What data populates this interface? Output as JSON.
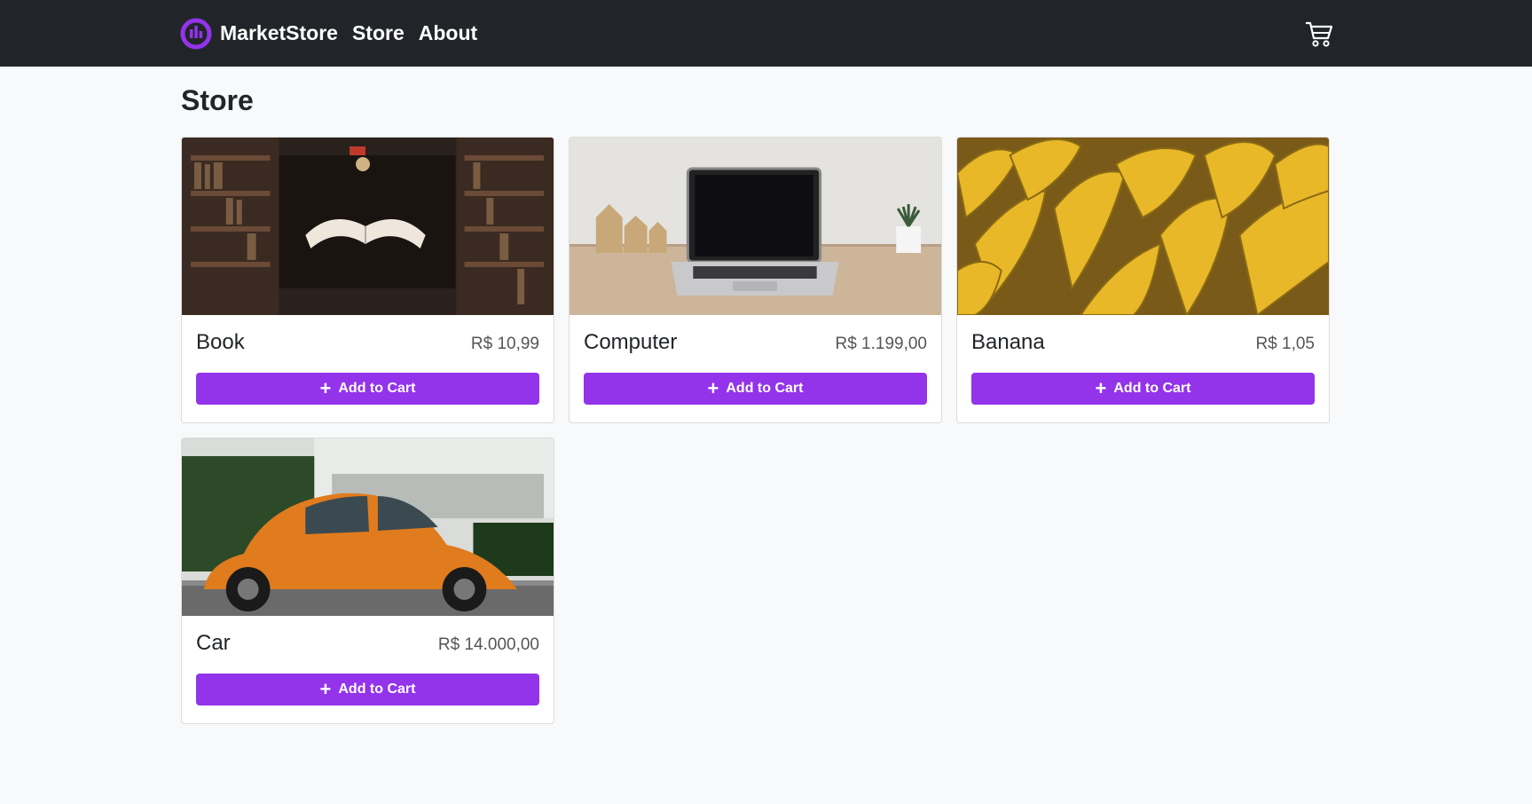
{
  "navbar": {
    "brand": "MarketStore",
    "links": [
      "Store",
      "About"
    ],
    "brand_color": "#9333ea",
    "cart_icon": "shopping-cart-icon"
  },
  "page": {
    "title": "Store"
  },
  "products": [
    {
      "name": "Book",
      "price": "R$ 10,99",
      "button": "Add to Cart",
      "image": "floating open book in library aisle"
    },
    {
      "name": "Computer",
      "price": "R$ 1.199,00",
      "button": "Add to Cart",
      "image": "laptop on wooden desk"
    },
    {
      "name": "Banana",
      "price": "R$ 1,05",
      "button": "Add to Cart",
      "image": "bunches of bananas"
    },
    {
      "name": "Car",
      "price": "R$ 14.000,00",
      "button": "Add to Cart",
      "image": "orange vintage beetle car"
    }
  ],
  "colors": {
    "accent": "#9333ea",
    "navbar_bg": "#212529",
    "page_bg": "#f8f9fa"
  }
}
